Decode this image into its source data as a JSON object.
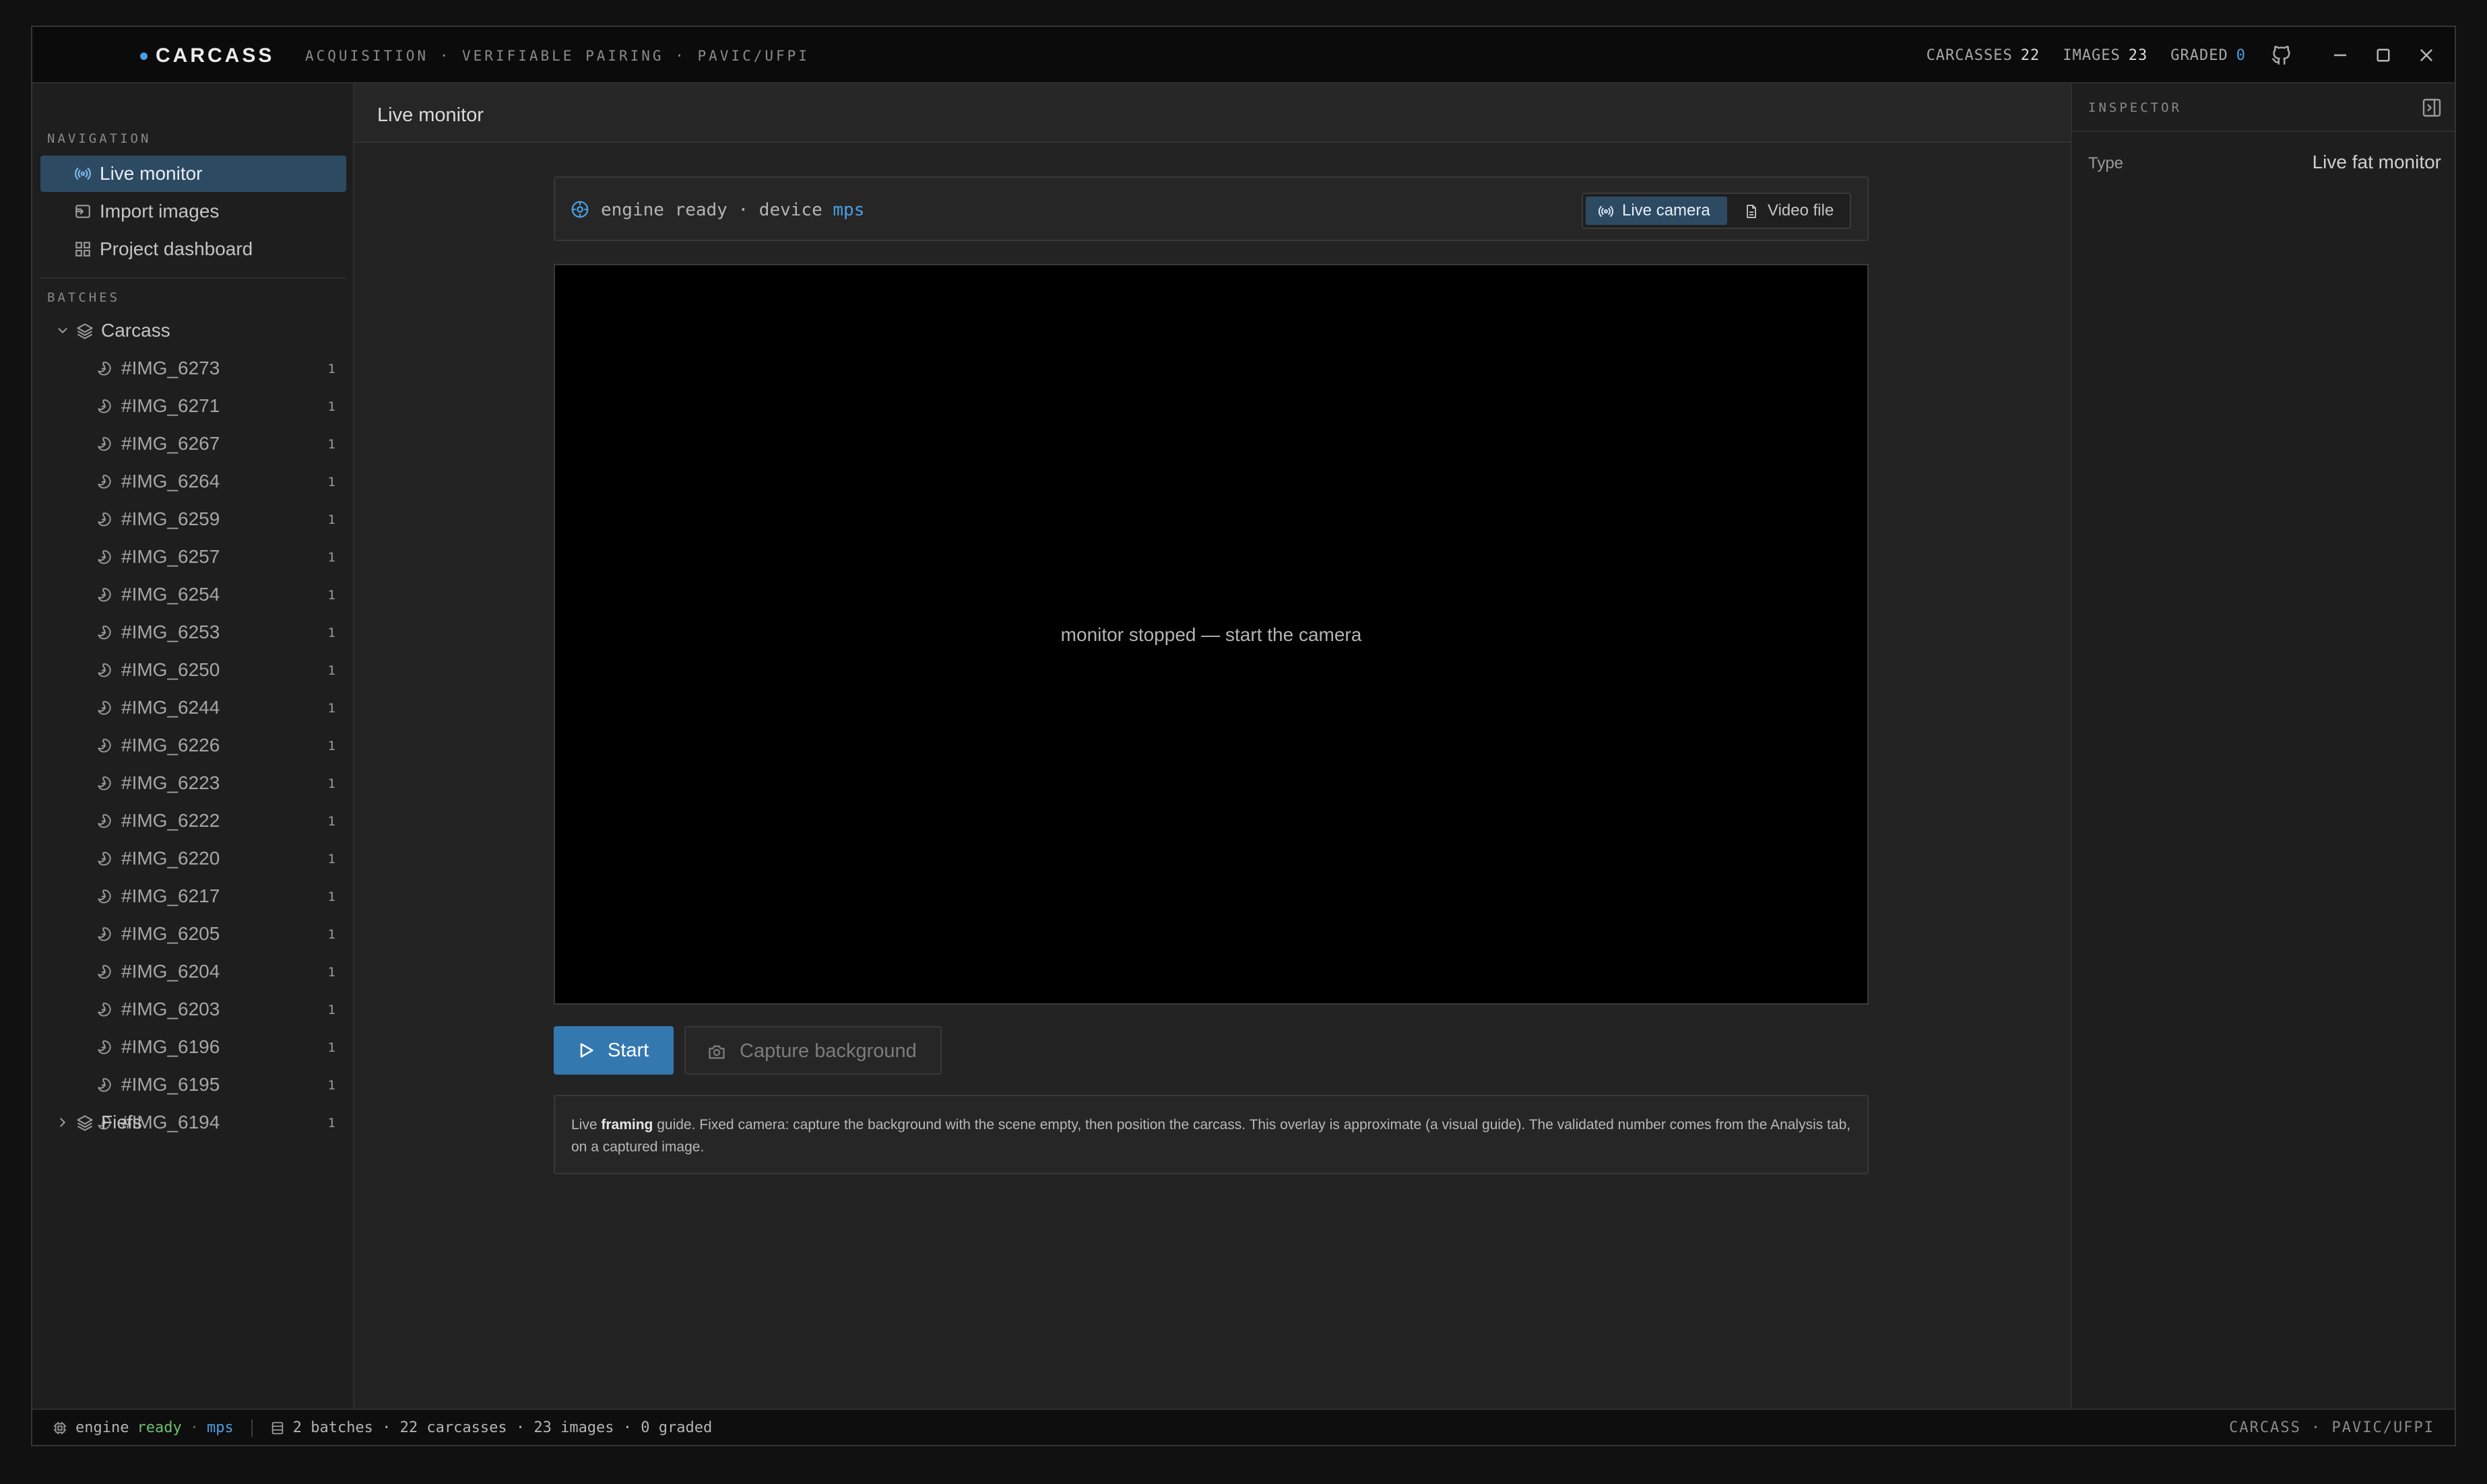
{
  "titlebar": {
    "brand": "CARCASS",
    "subtitle": "ACQUISITION · VERIFIABLE PAIRING · PAVIC/UFPI",
    "stats": [
      {
        "label": "CARCASSES",
        "value": "22"
      },
      {
        "label": "IMAGES",
        "value": "23"
      },
      {
        "label": "GRADED",
        "value": "0"
      }
    ]
  },
  "sidebar": {
    "nav_label": "NAVIGATION",
    "nav": [
      {
        "label": "Live monitor"
      },
      {
        "label": "Import images"
      },
      {
        "label": "Project dashboard"
      }
    ],
    "batches_label": "BATCHES",
    "batches": [
      {
        "label": "Carcass",
        "images": [
          {
            "label": "#IMG_6273",
            "count": "1"
          },
          {
            "label": "#IMG_6271",
            "count": "1"
          },
          {
            "label": "#IMG_6267",
            "count": "1"
          },
          {
            "label": "#IMG_6264",
            "count": "1"
          },
          {
            "label": "#IMG_6259",
            "count": "1"
          },
          {
            "label": "#IMG_6257",
            "count": "1"
          },
          {
            "label": "#IMG_6254",
            "count": "1"
          },
          {
            "label": "#IMG_6253",
            "count": "1"
          },
          {
            "label": "#IMG_6250",
            "count": "1"
          },
          {
            "label": "#IMG_6244",
            "count": "1"
          },
          {
            "label": "#IMG_6226",
            "count": "1"
          },
          {
            "label": "#IMG_6223",
            "count": "1"
          },
          {
            "label": "#IMG_6222",
            "count": "1"
          },
          {
            "label": "#IMG_6220",
            "count": "1"
          },
          {
            "label": "#IMG_6217",
            "count": "1"
          },
          {
            "label": "#IMG_6205",
            "count": "1"
          },
          {
            "label": "#IMG_6204",
            "count": "1"
          },
          {
            "label": "#IMG_6203",
            "count": "1"
          },
          {
            "label": "#IMG_6196",
            "count": "1"
          },
          {
            "label": "#IMG_6195",
            "count": "1"
          },
          {
            "label": "#IMG_6194",
            "count": "1"
          }
        ]
      },
      {
        "label": "Fiefs"
      }
    ]
  },
  "main": {
    "title": "Live monitor",
    "engine": {
      "text": "engine ready · device",
      "device": "mps"
    },
    "source_toggle": {
      "live": "Live camera",
      "video": "Video file"
    },
    "viewport_message": "monitor stopped — start the camera",
    "start_label": "Start",
    "capture_label": "Capture background",
    "guide": {
      "prefix": "Live ",
      "bold": "framing",
      "rest": " guide. Fixed camera: capture the background with the scene empty, then position the carcass. This overlay is approximate (a visual guide). The validated number comes from the Analysis tab, on a captured image."
    }
  },
  "inspector": {
    "title": "INSPECTOR",
    "type_key": "Type",
    "type_value": "Live fat monitor"
  },
  "statusbar": {
    "engine_label": "engine",
    "engine_status": "ready",
    "device": "mps",
    "summary": "2 batches · 22 carcasses · 23 images · 0 graded",
    "right": "CARCASS · PAVIC/UFPI"
  },
  "colors": {
    "accent": "#4a9fe3",
    "selected": "#2d4a63",
    "primary_button": "#3478b0",
    "ready_green": "#6cc070"
  }
}
